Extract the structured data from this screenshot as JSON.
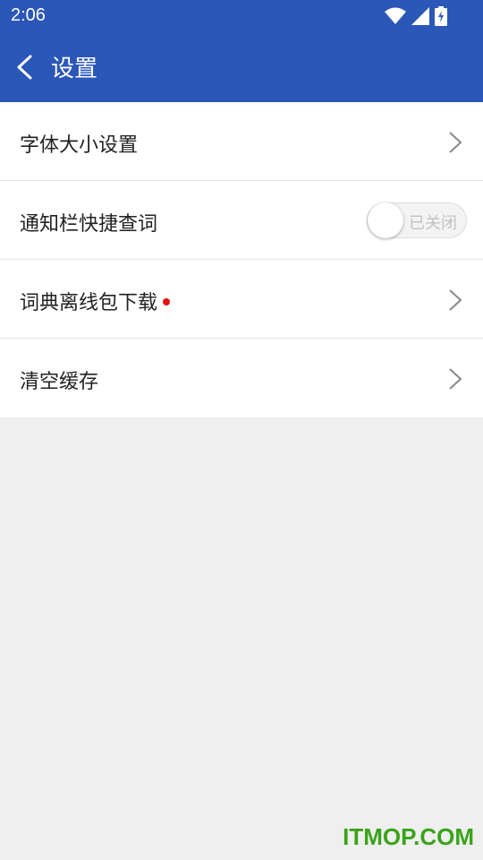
{
  "status_bar": {
    "time": "2:06",
    "icons": [
      "wifi-icon",
      "cellular-signal-icon",
      "battery-charging-icon"
    ]
  },
  "app_bar": {
    "back_icon": "chevron-left-icon",
    "title": "设置",
    "color": "#2a57b8"
  },
  "settings": {
    "items": [
      {
        "label": "字体大小设置",
        "control": "chevron"
      },
      {
        "label": "通知栏快捷查词",
        "control": "toggle",
        "toggle_text": "已关闭",
        "toggle_on": false
      },
      {
        "label": "词典离线包下载",
        "control": "chevron",
        "badge": "red-dot"
      },
      {
        "label": "清空缓存",
        "control": "chevron"
      }
    ]
  },
  "watermark": {
    "text": "ITMOP.COM",
    "color": "#3aa31a"
  }
}
